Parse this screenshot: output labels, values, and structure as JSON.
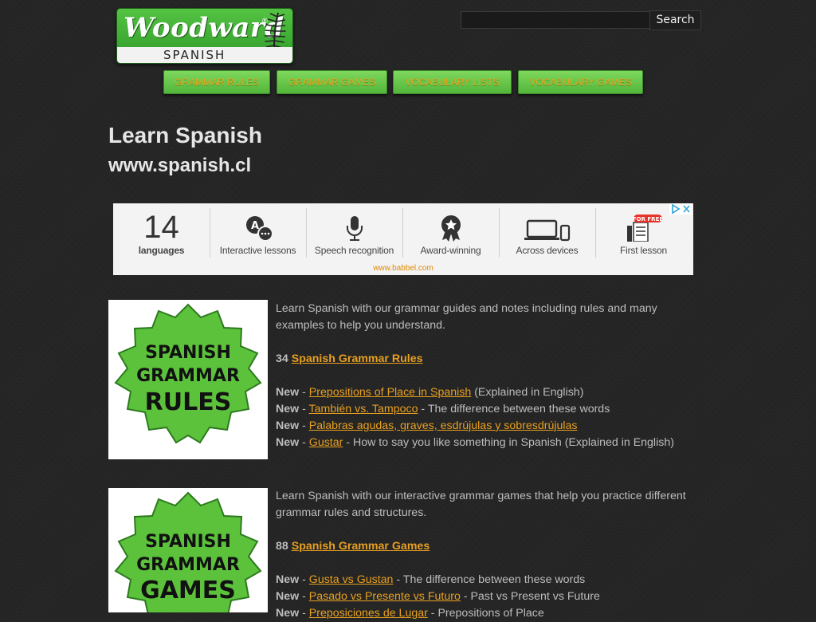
{
  "logo": {
    "word": "Woodward",
    "sub": "SPANISH",
    "reg": "®"
  },
  "search": {
    "placeholder": "",
    "button": "Search"
  },
  "nav": [
    {
      "label": "Grammar Rules"
    },
    {
      "label": "Grammar Games"
    },
    {
      "label": "Vocabulary Lists"
    },
    {
      "label": "Vocabulary Games"
    }
  ],
  "heading": {
    "title": "Learn Spanish",
    "url": "www.spanish.cl"
  },
  "ad": {
    "number": "14",
    "items": [
      {
        "label": "languages",
        "icon": "number"
      },
      {
        "label": "Interactive lessons",
        "icon": "chat-bubbles-icon"
      },
      {
        "label": "Speech recognition",
        "icon": "microphone-icon"
      },
      {
        "label": "Award-winning",
        "icon": "award-star-icon"
      },
      {
        "label": "Across devices",
        "icon": "devices-icon"
      },
      {
        "label": "First lesson",
        "icon": "lesson-free-icon"
      }
    ],
    "free_tag": "FOR FREE",
    "url": "www.babbel.com"
  },
  "sections": [
    {
      "badge": [
        "SPANISH",
        "GRAMMAR",
        "RULES"
      ],
      "intro": "Learn Spanish with our grammar guides and notes including rules and many examples to help you understand.",
      "count": "34",
      "main_link": "Spanish Grammar Rules",
      "new_label": "New",
      "items": [
        {
          "link": "Prepositions of Place in Spanish",
          "desc": " (Explained in English)"
        },
        {
          "link": "También vs. Tampoco",
          "desc": " - The difference between these words"
        },
        {
          "link": "Palabras agudas, graves, esdrújulas y sobresdrújulas",
          "desc": ""
        },
        {
          "link": "Gustar",
          "desc": " - How to say you like something in Spanish (Explained in English)"
        }
      ]
    },
    {
      "badge": [
        "SPANISH",
        "GRAMMAR",
        "GAMES"
      ],
      "intro": "Learn Spanish with our interactive grammar games that help you practice different grammar rules and structures.",
      "count": "88",
      "main_link": "Spanish Grammar Games",
      "new_label": "New",
      "items": [
        {
          "link": "Gusta vs Gustan",
          "desc": " - The difference between these words"
        },
        {
          "link": "Pasado vs Presente vs Futuro",
          "desc": " - Past vs Present vs Future"
        },
        {
          "link": "Preposiciones de Lugar",
          "desc": " - Prepositions of Place"
        }
      ]
    }
  ],
  "colors": {
    "background": "#262626",
    "nav_green": "#6ccb4d",
    "link_orange": "#e8a020",
    "badge_green": "#5cc23c"
  }
}
